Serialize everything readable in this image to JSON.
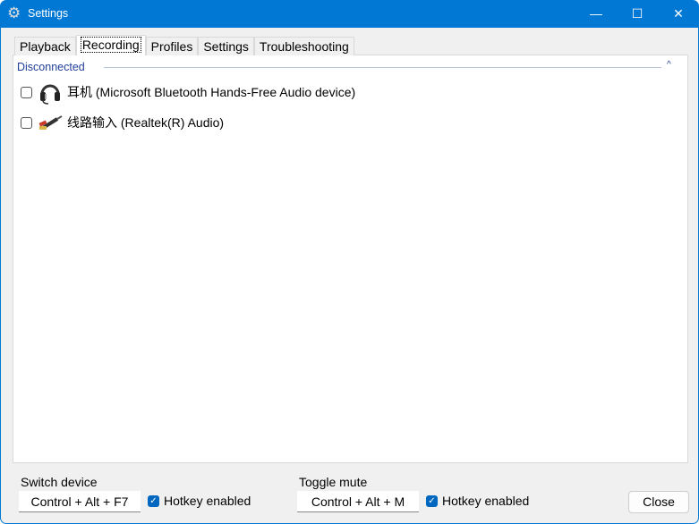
{
  "window": {
    "title": "Settings",
    "minimize": "—",
    "maximize": "☐",
    "close": "✕"
  },
  "tabs": [
    "Playback",
    "Recording",
    "Profiles",
    "Settings",
    "Troubleshooting"
  ],
  "group": {
    "label": "Disconnected",
    "collapse": "^"
  },
  "devices": [
    {
      "label": "耳机 (Microsoft Bluetooth Hands-Free Audio device)",
      "checked": false,
      "icon": "headset-icon"
    },
    {
      "label": "线路输入 (Realtek(R) Audio)",
      "checked": false,
      "icon": "line-in-cable-icon"
    }
  ],
  "switch_device": {
    "label": "Switch device",
    "hotkey": "Control + Alt + F7",
    "enabled_label": "Hotkey enabled",
    "enabled": true
  },
  "toggle_mute": {
    "label": "Toggle mute",
    "hotkey": "Control + Alt + M",
    "enabled_label": "Hotkey enabled",
    "enabled": true
  },
  "close_label": "Close",
  "colors": {
    "accent": "#0078d4",
    "group": "#1f3f9a"
  }
}
